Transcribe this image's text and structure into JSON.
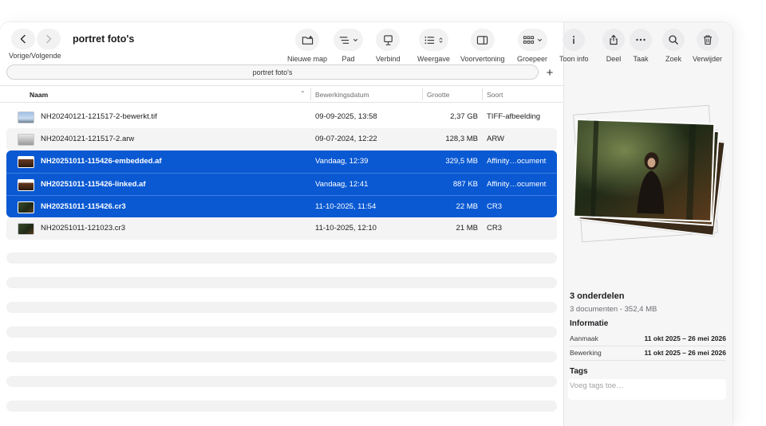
{
  "toolbar": {
    "nav_label": "Vorige/Volgende",
    "title": "portret foto's",
    "tools": {
      "new_folder": "Nieuwe map",
      "path": "Pad",
      "connect": "Verbind",
      "view": "Weergave",
      "preview": "Voorvertoning",
      "group": "Groepeer",
      "info": "Toon info",
      "share": "Deel",
      "task": "Taak",
      "search": "Zoek",
      "delete": "Verwijder"
    }
  },
  "pathbar": {
    "label": "portret foto's",
    "add": "+"
  },
  "columns": {
    "name": "Naam",
    "date": "Bewerkingsdatum",
    "size": "Grootte",
    "kind": "Soort"
  },
  "files": [
    {
      "name": "NH20240121-121517-2-bewerkt.tif",
      "date": "09-09-2025, 13:58",
      "size": "2,37 GB",
      "kind": "TIFF-afbeelding",
      "selected": false,
      "thumb": "sky"
    },
    {
      "name": "NH20240121-121517-2.arw",
      "date": "09-07-2024, 12:22",
      "size": "128,3 MB",
      "kind": "ARW",
      "selected": false,
      "thumb": "gray"
    },
    {
      "name": "NH20251011-115426-embedded.af",
      "date": "Vandaag, 12:39",
      "size": "329,5 MB",
      "kind": "Affinity…ocument",
      "selected": true,
      "thumb": "doc"
    },
    {
      "name": "NH20251011-115426-linked.af",
      "date": "Vandaag, 12:41",
      "size": "887 KB",
      "kind": "Affinity…ocument",
      "selected": true,
      "thumb": "doc"
    },
    {
      "name": "NH20251011-115426.cr3",
      "date": "11-10-2025, 11:54",
      "size": "22 MB",
      "kind": "CR3",
      "selected": true,
      "thumb": "forest"
    },
    {
      "name": "NH20251011-121023.cr3",
      "date": "11-10-2025, 12:10",
      "size": "21 MB",
      "kind": "CR3",
      "selected": false,
      "thumb": "forest"
    }
  ],
  "inspector": {
    "selection_count": "3 onderdelen",
    "selection_summary": "3 documenten - 352,4 MB",
    "info_title": "Informatie",
    "created_label": "Aanmaak",
    "created_value": "11 okt 2025 – 26 mei 2026",
    "modified_label": "Bewerking",
    "modified_value": "11 okt 2025 – 26 mei 2026",
    "tags_title": "Tags",
    "tags_placeholder": "Voeg tags toe…"
  },
  "colors": {
    "selection": "#0a59d3",
    "toolbar_button": "#f2f2f3",
    "inspector_bg": "#f6f6f7"
  }
}
